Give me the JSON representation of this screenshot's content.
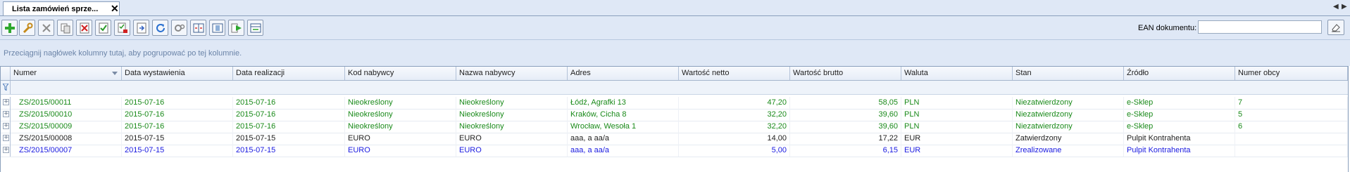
{
  "tab": {
    "title": "Lista zamówień sprze...",
    "close": "✕"
  },
  "tab_nav": {
    "prev": "◀",
    "next": "▶"
  },
  "toolbar": {
    "buttons": [
      {
        "name": "add-button",
        "icon": "plus-icon"
      },
      {
        "name": "edit-button",
        "icon": "wrench-icon"
      },
      {
        "name": "delete-button",
        "icon": "cross-icon"
      },
      {
        "name": "copy-button",
        "icon": "copy-document-icon"
      },
      {
        "name": "cancel-document-button",
        "icon": "cancel-document-icon"
      },
      {
        "name": "approve-document-button",
        "icon": "approve-document-icon"
      },
      {
        "name": "realize-document-button",
        "icon": "realize-document-icon"
      },
      {
        "name": "export-document-button",
        "icon": "export-document-icon"
      },
      {
        "name": "refresh-button",
        "icon": "refresh-icon"
      },
      {
        "name": "tools-button",
        "icon": "gears-icon"
      },
      {
        "name": "split-view-button",
        "icon": "split-view-icon"
      },
      {
        "name": "columns-button",
        "icon": "columns-icon"
      },
      {
        "name": "run-button",
        "icon": "play-icon"
      },
      {
        "name": "layout-button",
        "icon": "layout-icon"
      }
    ],
    "ean_label": "EAN dokumentu:",
    "ean_value": "",
    "ean_clear_icon": "eraser-icon"
  },
  "group_hint": "Przeciągnij nagłówek kolumny tutaj, aby pogrupować po tej kolumnie.",
  "columns": [
    "Numer",
    "Data wystawienia",
    "Data realizacji",
    "Kod nabywcy",
    "Nazwa nabywcy",
    "Adres",
    "Wartość netto",
    "Wartość brutto",
    "Waluta",
    "Stan",
    "Źródło",
    "Numer obcy"
  ],
  "colors": {
    "green": "#1a8a1a",
    "black": "#1e1e1e",
    "blue": "#1a1ae0"
  },
  "rows": [
    {
      "numer": "ZS/2015/00011",
      "data_wyst": "2015-07-16",
      "data_real": "2015-07-16",
      "kod": "Nieokreślony",
      "nazwa": "Nieokreślony",
      "adres": "Łódź, Agrafki 13",
      "netto": "47,20",
      "brutto": "58,05",
      "waluta": "PLN",
      "stan": "Niezatwierdzony",
      "zrodlo": "e-Sklep",
      "numer_obcy": "7",
      "color": "green"
    },
    {
      "numer": "ZS/2015/00010",
      "data_wyst": "2015-07-16",
      "data_real": "2015-07-16",
      "kod": "Nieokreślony",
      "nazwa": "Nieokreślony",
      "adres": "Kraków, Cicha 8",
      "netto": "32,20",
      "brutto": "39,60",
      "waluta": "PLN",
      "stan": "Niezatwierdzony",
      "zrodlo": "e-Sklep",
      "numer_obcy": "5",
      "color": "green"
    },
    {
      "numer": "ZS/2015/00009",
      "data_wyst": "2015-07-16",
      "data_real": "2015-07-16",
      "kod": "Nieokreślony",
      "nazwa": "Nieokreślony",
      "adres": "Wrocław, Wesoła 1",
      "netto": "32,20",
      "brutto": "39,60",
      "waluta": "PLN",
      "stan": "Niezatwierdzony",
      "zrodlo": "e-Sklep",
      "numer_obcy": "6",
      "color": "green"
    },
    {
      "numer": "ZS/2015/00008",
      "data_wyst": "2015-07-15",
      "data_real": "2015-07-15",
      "kod": "EURO",
      "nazwa": "EURO",
      "adres": "aaa, a aa/a",
      "netto": "14,00",
      "brutto": "17,22",
      "waluta": "EUR",
      "stan": "Zatwierdzony",
      "zrodlo": "Pulpit Kontrahenta",
      "numer_obcy": "",
      "color": "black"
    },
    {
      "numer": "ZS/2015/00007",
      "data_wyst": "2015-07-15",
      "data_real": "2015-07-15",
      "kod": "EURO",
      "nazwa": "EURO",
      "adres": "aaa, a aa/a",
      "netto": "5,00",
      "brutto": "6,15",
      "waluta": "EUR",
      "stan": "Zrealizowane",
      "zrodlo": "Pulpit Kontrahenta",
      "numer_obcy": "",
      "color": "blue"
    }
  ]
}
